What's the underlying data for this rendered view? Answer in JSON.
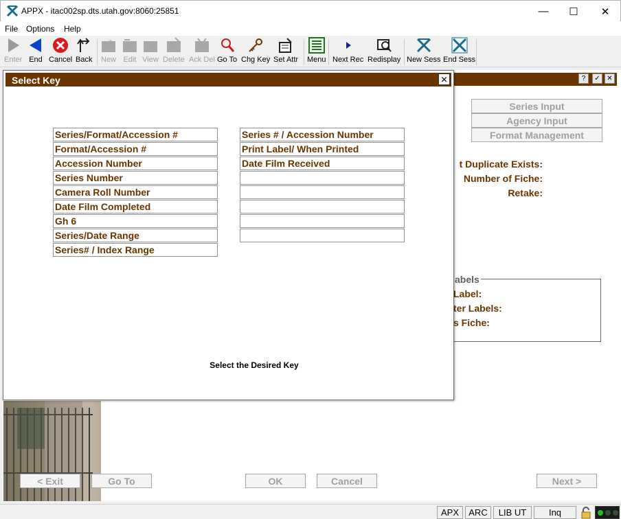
{
  "window": {
    "title": "APPX - itac002sp.dts.utah.gov:8060:25851",
    "minimize": "—",
    "maximize": "☐",
    "close": "✕"
  },
  "menu": [
    "File",
    "Options",
    "Help"
  ],
  "toolbar": [
    {
      "label": "Enter",
      "icon": "enter-arrow-icon",
      "enabled": false
    },
    {
      "label": "End",
      "icon": "end-arrow-icon",
      "enabled": true
    },
    {
      "label": "Cancel",
      "icon": "cancel-icon",
      "enabled": true
    },
    {
      "label": "Back",
      "icon": "back-icon",
      "enabled": true
    },
    {
      "label": "New",
      "icon": "new-icon",
      "enabled": false
    },
    {
      "label": "Edit",
      "icon": "edit-icon",
      "enabled": false
    },
    {
      "label": "View",
      "icon": "view-icon",
      "enabled": false
    },
    {
      "label": "Delete",
      "icon": "delete-icon",
      "enabled": false
    },
    {
      "label": "Ack Del",
      "icon": "ack-delete-icon",
      "enabled": false
    },
    {
      "label": "Go To",
      "icon": "magnifier-icon",
      "enabled": true
    },
    {
      "label": "Chg Key",
      "icon": "key-icon",
      "enabled": true
    },
    {
      "label": "Set Attr",
      "icon": "set-attributes-icon",
      "enabled": true
    },
    {
      "label": "Menu",
      "icon": "menu-list-icon",
      "enabled": true
    },
    {
      "label": "Next Rec",
      "icon": "next-record-icon",
      "enabled": true
    },
    {
      "label": "Redisplay",
      "icon": "redisplay-icon",
      "enabled": true
    },
    {
      "label": "New Sess",
      "icon": "new-session-icon",
      "enabled": true
    },
    {
      "label": "End Sess",
      "icon": "end-session-icon",
      "enabled": true
    }
  ],
  "background": {
    "buttons": [
      "Series Input",
      "Agency Input",
      "Format Management"
    ],
    "fields": [
      "t Duplicate Exists:",
      "Number of Fiche:",
      "Retake:"
    ],
    "group_title": "abels",
    "group_fields": [
      "Label:",
      "ter Labels:",
      "s Fiche:"
    ],
    "window_controls": [
      "?",
      "✓",
      "✕"
    ]
  },
  "dialog": {
    "title": "Select Key",
    "close": "✕",
    "keys_left": [
      "Series/Format/Accession #",
      "Format/Accession #",
      "Accession Number",
      "Series Number",
      "Camera Roll Number",
      "Date Film Completed",
      "Gh 6",
      "Series/Date Range",
      "Series# / Index Range"
    ],
    "keys_right": [
      "Series # / Accession Number",
      "Print Label/ When Printed",
      "Date Film Received",
      "",
      "",
      "",
      "",
      ""
    ],
    "prompt": "Select the Desired Key"
  },
  "bottom_buttons": {
    "exit": "< Exit",
    "goto": "Go To",
    "ok": "OK",
    "cancel": "Cancel",
    "next": "Next >"
  },
  "statusbar": {
    "apx": "APX",
    "arc": "ARC",
    "lib": "LIB UT",
    "mode": "Inq"
  },
  "colors": {
    "accent_brown": "#6b3500",
    "disabled_gray": "#a0a0a0"
  }
}
